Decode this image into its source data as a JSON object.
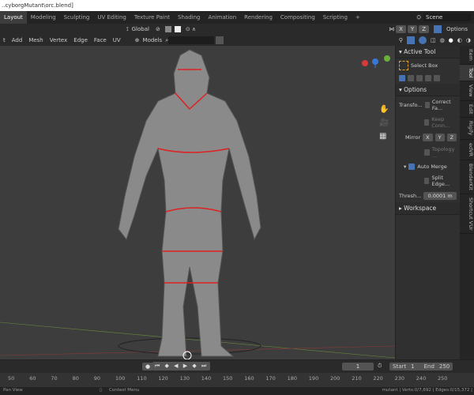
{
  "title": "..cyborgMutant\\orc.blend]",
  "workspace_tabs": [
    "Layout",
    "Modeling",
    "Sculpting",
    "UV Editing",
    "Texture Paint",
    "Shading",
    "Animation",
    "Rendering",
    "Compositing",
    "Scripting",
    "+"
  ],
  "scene": "Scene",
  "header1": {
    "orientation": "Global",
    "options": "Options",
    "axes": [
      "X",
      "Y",
      "Z"
    ]
  },
  "header2": {
    "menus": [
      "t",
      "Add",
      "Mesh",
      "Vertex",
      "Edge",
      "Face",
      "UV"
    ],
    "collection": "Models",
    "search_placeholder": ""
  },
  "npanel": {
    "active_tool_title": "Active Tool",
    "tool_name": "Select Box",
    "options_title": "Options",
    "transform_label": "Transfo...",
    "correct_face": "Correct Fa...",
    "keep_conn": "Keep Conn...",
    "mirror_label": "Mirror",
    "mirror_axes": [
      "X",
      "Y",
      "Z"
    ],
    "topology": "Topology ...",
    "auto_merge": "Auto Merge",
    "split_edge": "Split Edge...",
    "thresh_label": "Thresh...",
    "thresh_value": "0.0001 m",
    "workspace": "Workspace",
    "tabs": [
      "Item",
      "Tool",
      "View",
      "Edit",
      "Rigify",
      "edVR",
      "BlenderKit",
      "Shortcut VUr"
    ]
  },
  "timeline": {
    "current_frame": "1",
    "start_label": "Start",
    "start": "1",
    "end_label": "End",
    "end": "250",
    "ruler": [
      "50",
      "60",
      "70",
      "80",
      "90",
      "100",
      "110",
      "120",
      "130",
      "140",
      "150",
      "160",
      "170",
      "180",
      "190",
      "200",
      "210",
      "220",
      "230",
      "240",
      "250"
    ]
  },
  "status": {
    "left": "Pan View",
    "middle": "Context Menu",
    "right": "mutant | Verts:0/7,692 | Edges:0/15,372 |"
  }
}
